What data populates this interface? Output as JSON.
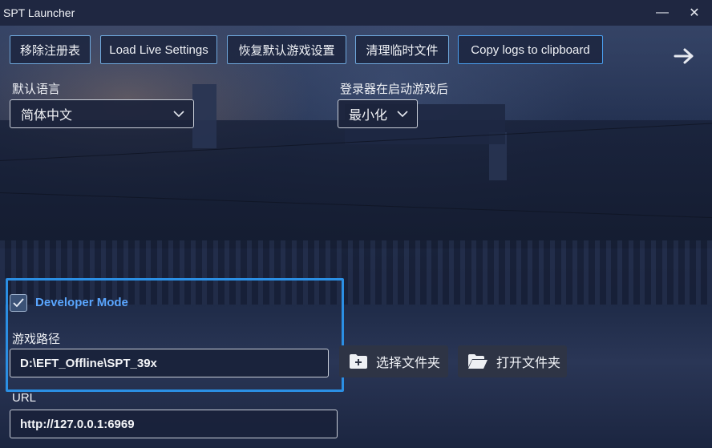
{
  "window": {
    "title": "SPT Launcher",
    "minimize_glyph": "—",
    "close_glyph": "✕"
  },
  "toolbar": {
    "buttons": [
      {
        "label": "移除注册表"
      },
      {
        "label": "Load Live Settings"
      },
      {
        "label": "恢复默认游戏设置"
      },
      {
        "label": "清理临时文件"
      },
      {
        "label": "Copy logs to clipboard"
      }
    ],
    "next_icon": "arrow-right-icon"
  },
  "language": {
    "label": "默认语言",
    "selected": "简体中文"
  },
  "launcher_action": {
    "label": "登录器在启动游戏后",
    "selected": "最小化"
  },
  "developer": {
    "mode_label": "Developer Mode",
    "checked": true,
    "game_path_label": "游戏路径",
    "game_path_value": "D:\\EFT_Offline\\SPT_39x",
    "select_folder_label": "选择文件夹",
    "open_folder_label": "打开文件夹",
    "url_label": "URL",
    "url_value": "http://127.0.0.1:6969"
  },
  "colors": {
    "accent": "#2b8fe4",
    "dev_label": "#5aa6ff",
    "button_border": "#6fa8dc",
    "titlebar": "#1f2741"
  }
}
